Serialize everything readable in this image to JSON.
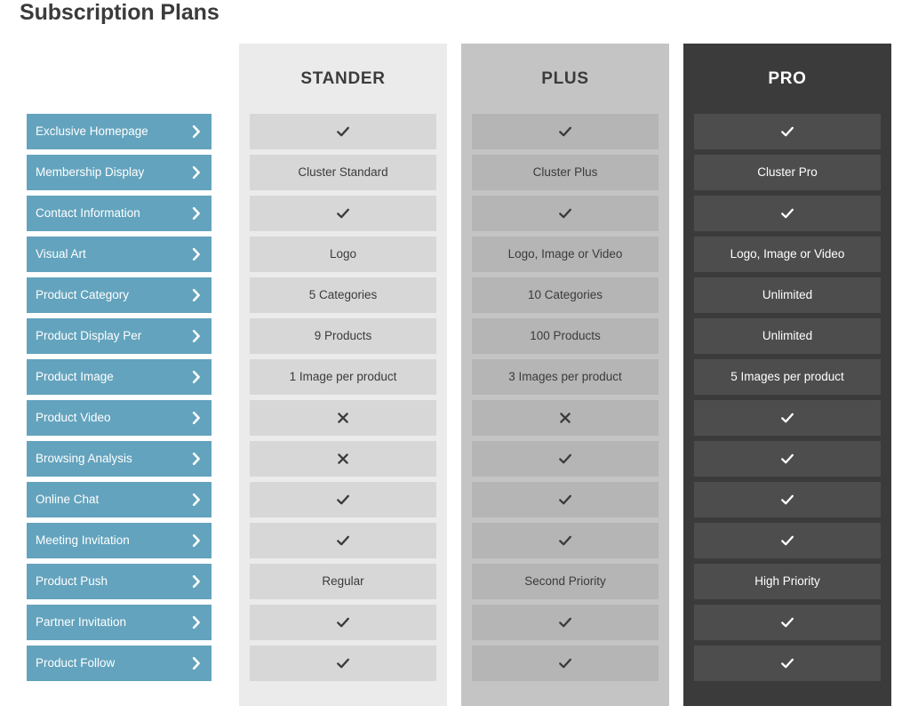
{
  "page": {
    "title": "Subscription Plans"
  },
  "colors": {
    "feature_button": "#63a3bd",
    "feature_text": "#ffffff",
    "title_text": "#3b3b3b",
    "stander_panel": "#ebebeb",
    "stander_cell": "#d7d7d7",
    "plus_panel": "#c4c4c4",
    "plus_cell": "#b5b5b5",
    "pro_panel": "#3b3b3b",
    "pro_cell": "#4d4d4d",
    "page_background": "#ffffff"
  },
  "features": [
    {
      "label": "Exclusive Homepage",
      "icon": "chevron-right-icon"
    },
    {
      "label": "Membership Display",
      "icon": "chevron-right-icon"
    },
    {
      "label": "Contact Information",
      "icon": "chevron-right-icon"
    },
    {
      "label": "Visual Art",
      "icon": "chevron-right-icon"
    },
    {
      "label": "Product Category",
      "icon": "chevron-right-icon"
    },
    {
      "label": "Product Display Per",
      "icon": "chevron-right-icon"
    },
    {
      "label": "Product Image",
      "icon": "chevron-right-icon"
    },
    {
      "label": "Product Video",
      "icon": "chevron-right-icon"
    },
    {
      "label": "Browsing Analysis",
      "icon": "chevron-right-icon"
    },
    {
      "label": "Online Chat",
      "icon": "chevron-right-icon"
    },
    {
      "label": "Meeting Invitation",
      "icon": "chevron-right-icon"
    },
    {
      "label": "Product Push",
      "icon": "chevron-right-icon"
    },
    {
      "label": "Partner Invitation",
      "icon": "chevron-right-icon"
    },
    {
      "label": "Product Follow",
      "icon": "chevron-right-icon"
    }
  ],
  "plans": [
    {
      "name": "STANDER",
      "cells": [
        {
          "type": "check",
          "icon": "check-icon",
          "text": ""
        },
        {
          "type": "text",
          "icon": "",
          "text": "Cluster Standard"
        },
        {
          "type": "check",
          "icon": "check-icon",
          "text": ""
        },
        {
          "type": "text",
          "icon": "",
          "text": "Logo"
        },
        {
          "type": "text",
          "icon": "",
          "text": "5 Categories"
        },
        {
          "type": "text",
          "icon": "",
          "text": "9 Products"
        },
        {
          "type": "text",
          "icon": "",
          "text": "1 Image per product"
        },
        {
          "type": "cross",
          "icon": "cross-icon",
          "text": ""
        },
        {
          "type": "cross",
          "icon": "cross-icon",
          "text": ""
        },
        {
          "type": "check",
          "icon": "check-icon",
          "text": ""
        },
        {
          "type": "check",
          "icon": "check-icon",
          "text": ""
        },
        {
          "type": "text",
          "icon": "",
          "text": "Regular"
        },
        {
          "type": "check",
          "icon": "check-icon",
          "text": ""
        },
        {
          "type": "check",
          "icon": "check-icon",
          "text": ""
        }
      ]
    },
    {
      "name": "PLUS",
      "cells": [
        {
          "type": "check",
          "icon": "check-icon",
          "text": ""
        },
        {
          "type": "text",
          "icon": "",
          "text": "Cluster Plus"
        },
        {
          "type": "check",
          "icon": "check-icon",
          "text": ""
        },
        {
          "type": "text",
          "icon": "",
          "text": "Logo, Image or Video"
        },
        {
          "type": "text",
          "icon": "",
          "text": "10 Categories"
        },
        {
          "type": "text",
          "icon": "",
          "text": "100 Products"
        },
        {
          "type": "text",
          "icon": "",
          "text": "3 Images per product"
        },
        {
          "type": "cross",
          "icon": "cross-icon",
          "text": ""
        },
        {
          "type": "check",
          "icon": "check-icon",
          "text": ""
        },
        {
          "type": "check",
          "icon": "check-icon",
          "text": ""
        },
        {
          "type": "check",
          "icon": "check-icon",
          "text": ""
        },
        {
          "type": "text",
          "icon": "",
          "text": "Second Priority"
        },
        {
          "type": "check",
          "icon": "check-icon",
          "text": ""
        },
        {
          "type": "check",
          "icon": "check-icon",
          "text": ""
        }
      ]
    },
    {
      "name": "PRO",
      "cells": [
        {
          "type": "check",
          "icon": "check-icon",
          "text": ""
        },
        {
          "type": "text",
          "icon": "",
          "text": "Cluster Pro"
        },
        {
          "type": "check",
          "icon": "check-icon",
          "text": ""
        },
        {
          "type": "text",
          "icon": "",
          "text": "Logo, Image or Video"
        },
        {
          "type": "text",
          "icon": "",
          "text": "Unlimited"
        },
        {
          "type": "text",
          "icon": "",
          "text": "Unlimited"
        },
        {
          "type": "text",
          "icon": "",
          "text": "5 Images per product"
        },
        {
          "type": "check",
          "icon": "check-icon",
          "text": ""
        },
        {
          "type": "check",
          "icon": "check-icon",
          "text": ""
        },
        {
          "type": "check",
          "icon": "check-icon",
          "text": ""
        },
        {
          "type": "check",
          "icon": "check-icon",
          "text": ""
        },
        {
          "type": "text",
          "icon": "",
          "text": "High Priority"
        },
        {
          "type": "check",
          "icon": "check-icon",
          "text": ""
        },
        {
          "type": "check",
          "icon": "check-icon",
          "text": ""
        }
      ]
    }
  ]
}
